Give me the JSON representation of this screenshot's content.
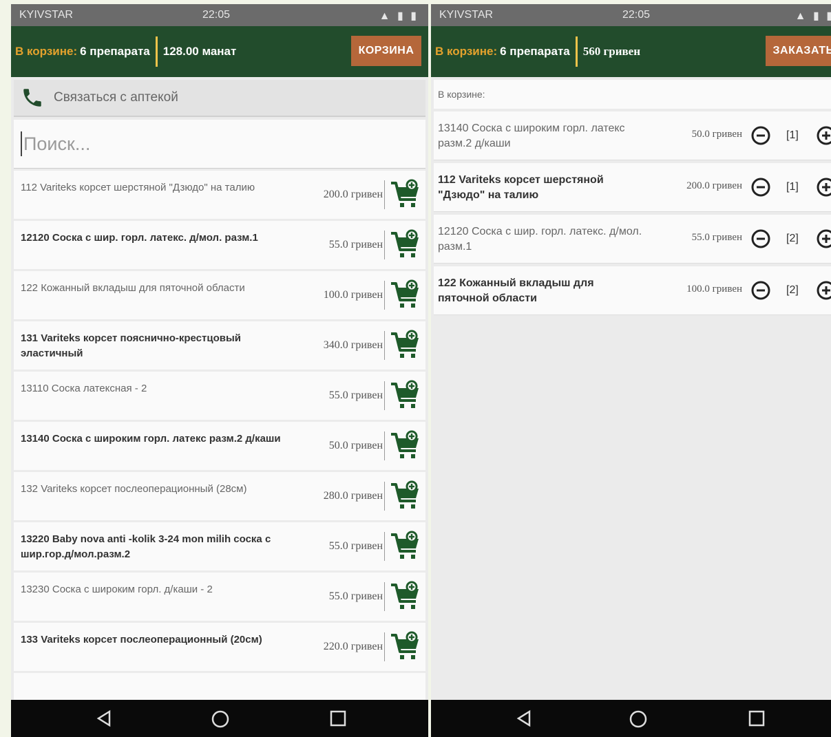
{
  "status_bar": {
    "carrier": "KYIVSTAR",
    "time": "22:05"
  },
  "catalog": {
    "cart_label": "В корзине:",
    "count_label": "6 препарата",
    "total": "128.00 манат",
    "cart_button": "КОРЗИНА",
    "contact_label": "Связаться с аптекой",
    "search_placeholder": "Поиск...",
    "products": [
      {
        "name": "112 Variteks корсет шерстяной \"Дзюдо\" на талию",
        "price": "200.0 гривен",
        "bold": false
      },
      {
        "name": "12120 Соска с шир. горл. латекс. д/мол. разм.1",
        "price": "55.0 гривен",
        "bold": true
      },
      {
        "name": "122 Кожанный вкладыш для пяточной области",
        "price": "100.0 гривен",
        "bold": false
      },
      {
        "name": "131  Variteks корсет пояснично-крестцовый эластичный",
        "price": "340.0 гривен",
        "bold": true
      },
      {
        "name": "13110 Соска латексная - 2",
        "price": "55.0 гривен",
        "bold": false
      },
      {
        "name": "13140 Соска с широким горл. латекс разм.2 д/каши",
        "price": "50.0 гривен",
        "bold": true
      },
      {
        "name": "132 Variteks корсет послеоперационный (28см)",
        "price": "280.0 гривен",
        "bold": false
      },
      {
        "name": "13220 Baby nova anti -kolik 3-24 mon milih соска с шир.гор.д/мол.разм.2",
        "price": "55.0 гривен",
        "bold": true
      },
      {
        "name": "13230 Соска с широким горл. д/каши - 2",
        "price": "55.0 гривен",
        "bold": false
      },
      {
        "name": "133 Variteks корсет послеоперационный (20см)",
        "price": "220.0 гривен",
        "bold": true
      }
    ]
  },
  "cart": {
    "cart_label": "В корзине:",
    "count_label": "6 препарата",
    "total": "560 гривен",
    "order_button": "ЗАКАЗАТЬ",
    "section_label": "В корзине:",
    "items": [
      {
        "name": "13140 Соска с широким горл. латекс разм.2 д/каши",
        "price": "50.0 гривен",
        "qty": "[1]",
        "bold": false
      },
      {
        "name": "112 Variteks корсет шерстяной \"Дзюдо\" на талию",
        "price": "200.0 гривен",
        "qty": "[1]",
        "bold": true
      },
      {
        "name": "12120 Соска с шир. горл. латекс. д/мол. разм.1",
        "price": "55.0 гривен",
        "qty": "[2]",
        "bold": false
      },
      {
        "name": "122 Кожанный вкладыш для пяточной области",
        "price": "100.0 гривен",
        "qty": "[2]",
        "bold": true
      }
    ]
  },
  "icons": {
    "phone": "phone-icon",
    "add_to_cart": "add-to-cart-icon",
    "minus": "minus-circle-icon",
    "plus": "plus-circle-icon",
    "back": "back-icon",
    "home": "home-icon",
    "recents": "recents-icon"
  },
  "colors": {
    "appbar": "#224c2c",
    "cart_label": "#e5a22d",
    "button": "#b5673a",
    "divider": "#f0c34a",
    "cart_icon": "#1e5a2a"
  }
}
